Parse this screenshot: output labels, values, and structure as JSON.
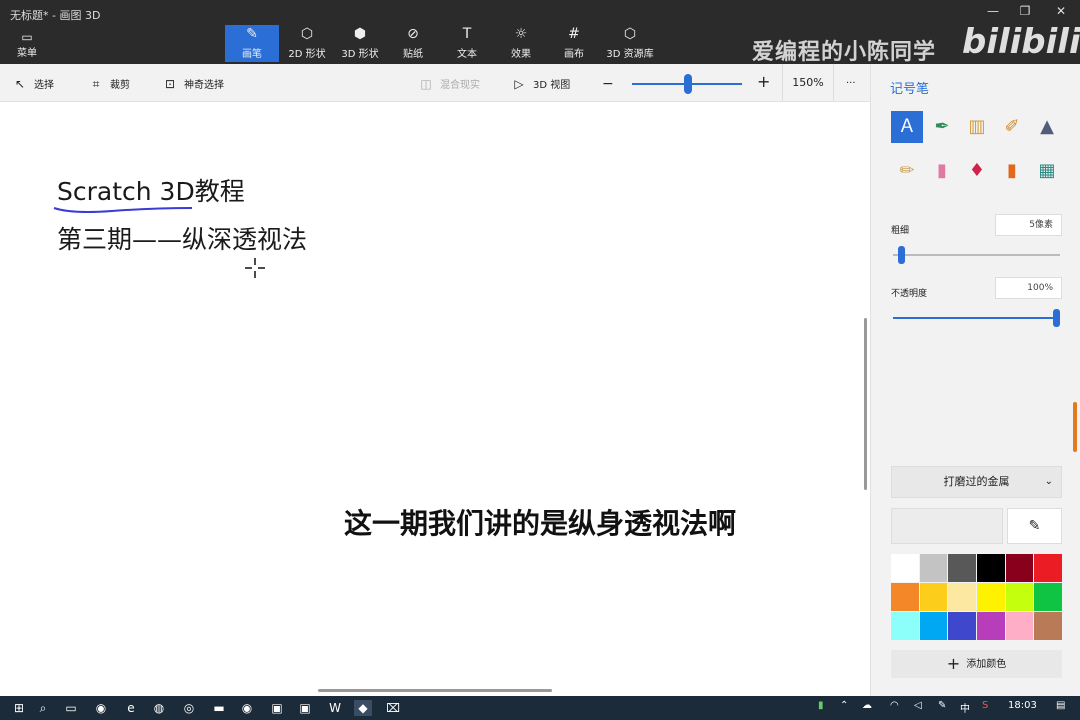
{
  "window": {
    "title": "无标题* - 画图 3D"
  },
  "menu": {
    "label": "菜单"
  },
  "tools": [
    {
      "label": "画笔",
      "icon": "brush-icon",
      "glyph": "✎"
    },
    {
      "label": "2D 形状",
      "icon": "shapes-2d-icon",
      "glyph": "⬡"
    },
    {
      "label": "3D 形状",
      "icon": "shapes-3d-icon",
      "glyph": "⬢"
    },
    {
      "label": "贴纸",
      "icon": "sticker-icon",
      "glyph": "⊘"
    },
    {
      "label": "文本",
      "icon": "text-icon",
      "glyph": "T"
    },
    {
      "label": "效果",
      "icon": "effects-icon",
      "glyph": "☼"
    },
    {
      "label": "画布",
      "icon": "canvas-icon",
      "glyph": "#"
    },
    {
      "label": "3D 资源库",
      "icon": "library-3d-icon",
      "glyph": "⬡"
    }
  ],
  "watermark": {
    "text": "爱编程的小陈同学",
    "logo": "bilibili"
  },
  "subbar": {
    "select": "选择",
    "crop": "裁剪",
    "magic_select": "神奇选择",
    "mixed_reality": "混合现实",
    "view_3d": "3D 视图",
    "zoom": "150%",
    "minus": "−",
    "plus": "+",
    "more": "···"
  },
  "canvas": {
    "line1": "Scratch 3D教程",
    "line2": "第三期——纵深透视法"
  },
  "caption": "这一期我们讲的是纵身透视法啊",
  "panel": {
    "title": "记号笔",
    "brushes": [
      {
        "name": "marker-icon",
        "glyph": "Ａ",
        "color": "#ffffff"
      },
      {
        "name": "calligraphy-pen-icon",
        "glyph": "✒",
        "color": "#2e8b57"
      },
      {
        "name": "oil-brush-icon",
        "glyph": "▥",
        "color": "#d49a3a"
      },
      {
        "name": "watercolor-icon",
        "glyph": "✐",
        "color": "#c98a2b"
      },
      {
        "name": "pixel-pen-icon",
        "glyph": "▲",
        "color": "#555c7a"
      },
      {
        "name": "pencil-icon",
        "glyph": "✏",
        "color": "#c9a35b"
      },
      {
        "name": "eraser-icon",
        "glyph": "▮",
        "color": "#e07aa0"
      },
      {
        "name": "crayon-icon",
        "glyph": "♦",
        "color": "#d0234b"
      },
      {
        "name": "spray-can-icon",
        "glyph": "▮",
        "color": "#e2661b"
      },
      {
        "name": "fill-bucket-icon",
        "glyph": "▦",
        "color": "#2b8a84"
      }
    ],
    "thickness_label": "粗细",
    "thickness_value": "5像素",
    "thickness_level": 0.05,
    "opacity_label": "不透明度",
    "opacity_value": "100%",
    "opacity_level": 1.0,
    "material": "打磨过的金属",
    "material_chevron": "⌄",
    "eyedropper_glyph": "✎",
    "swatches": [
      "#ffffff",
      "#c3c3c3",
      "#585858",
      "#000000",
      "#88001b",
      "#ec1c24",
      "#f48727",
      "#fdcd1c",
      "#fde8a2",
      "#fff200",
      "#c4ff0e",
      "#0ec442",
      "#8cfffb",
      "#00a8f3",
      "#3f48cc",
      "#b83dba",
      "#ffaec8",
      "#b97a57"
    ],
    "add_color": "添加颜色",
    "add_plus": "+"
  },
  "taskbar": {
    "icons": [
      {
        "name": "start-icon",
        "glyph": "⊞"
      },
      {
        "name": "search-icon",
        "glyph": "⌕"
      },
      {
        "name": "task-view-icon",
        "glyph": "▭"
      },
      {
        "name": "browser-icon",
        "glyph": "◉"
      },
      {
        "name": "edge-icon",
        "glyph": "e"
      },
      {
        "name": "wechat-icon",
        "glyph": "◍"
      },
      {
        "name": "chrome-icon",
        "glyph": "◎"
      },
      {
        "name": "file-explorer-icon",
        "glyph": "▬"
      },
      {
        "name": "app-green-icon",
        "glyph": "◉"
      },
      {
        "name": "app-window-icon",
        "glyph": "▣"
      },
      {
        "name": "app-blue-icon",
        "glyph": "▣"
      },
      {
        "name": "wps-icon",
        "glyph": "W"
      },
      {
        "name": "paint3d-icon",
        "glyph": "◆"
      },
      {
        "name": "capcut-icon",
        "glyph": "⌧"
      }
    ],
    "ime": "中",
    "time": "18:03"
  }
}
